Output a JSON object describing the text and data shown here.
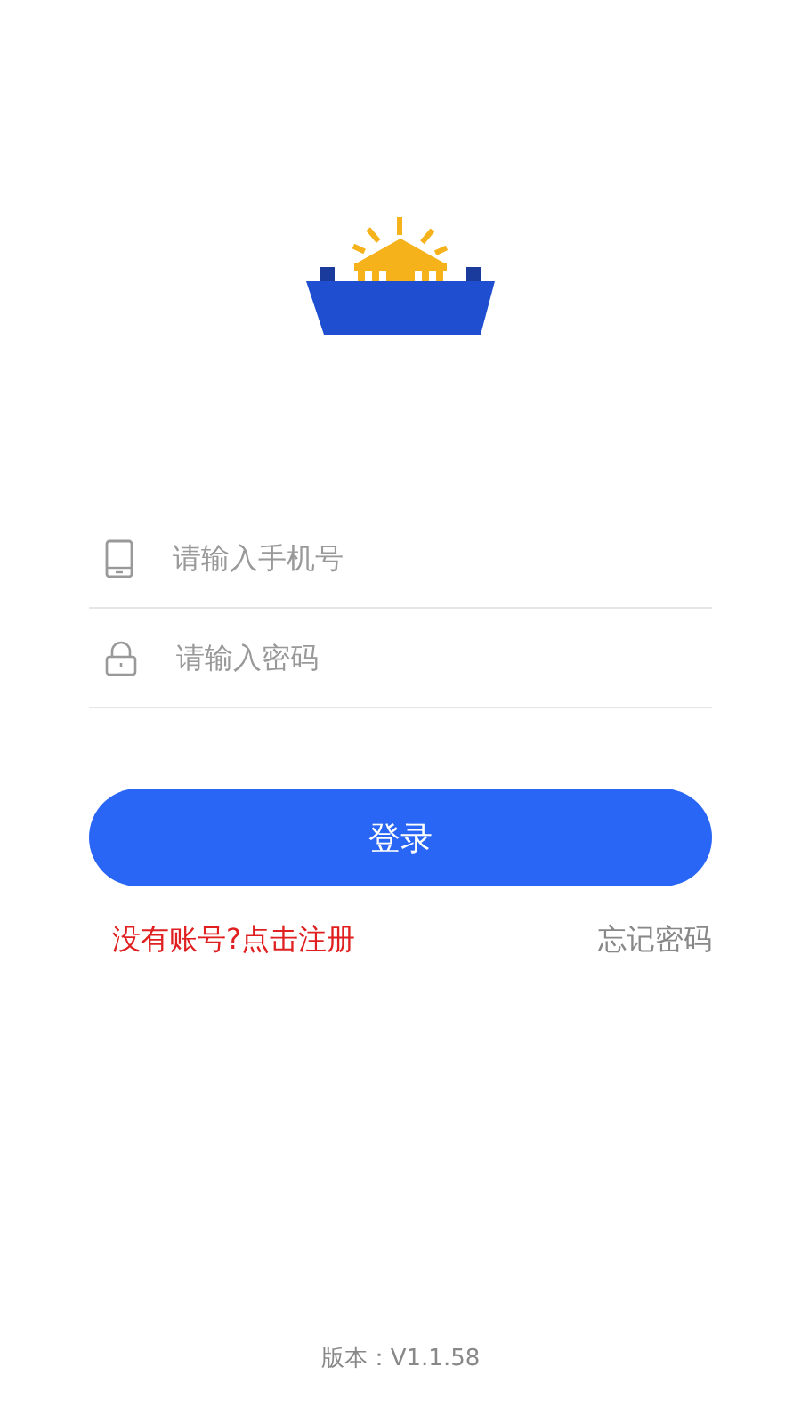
{
  "phone_field": {
    "placeholder": "请输入手机号"
  },
  "password_field": {
    "placeholder": "请输入密码"
  },
  "login_button": "登录",
  "register_link": "没有账号?点击注册",
  "forgot_link": "忘记密码",
  "version": "版本：V1.1.58"
}
